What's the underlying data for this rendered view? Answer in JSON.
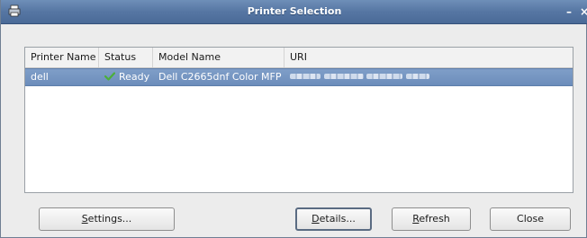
{
  "window": {
    "title": "Printer Selection",
    "minimize_glyph": "–",
    "close_glyph": "×",
    "icon": "printer-icon"
  },
  "table": {
    "columns": [
      "Printer Name",
      "Status",
      "Model Name",
      "URI"
    ],
    "rows": [
      {
        "name": "dell",
        "status": "Ready",
        "status_icon": "check-icon",
        "model": "Dell C2665dnf Color MFP",
        "uri": "",
        "uri_blurred": true,
        "selected": true
      }
    ]
  },
  "buttons": {
    "settings": {
      "mnemonic": "S",
      "rest": "ettings..."
    },
    "details": {
      "mnemonic": "D",
      "rest": "etails..."
    },
    "refresh": {
      "mnemonic": "R",
      "rest": "efresh"
    },
    "close": {
      "label": "Close"
    }
  },
  "colors": {
    "titlebar": "#5676a3",
    "selection": "#7396c6",
    "check": "#4caf3a"
  }
}
